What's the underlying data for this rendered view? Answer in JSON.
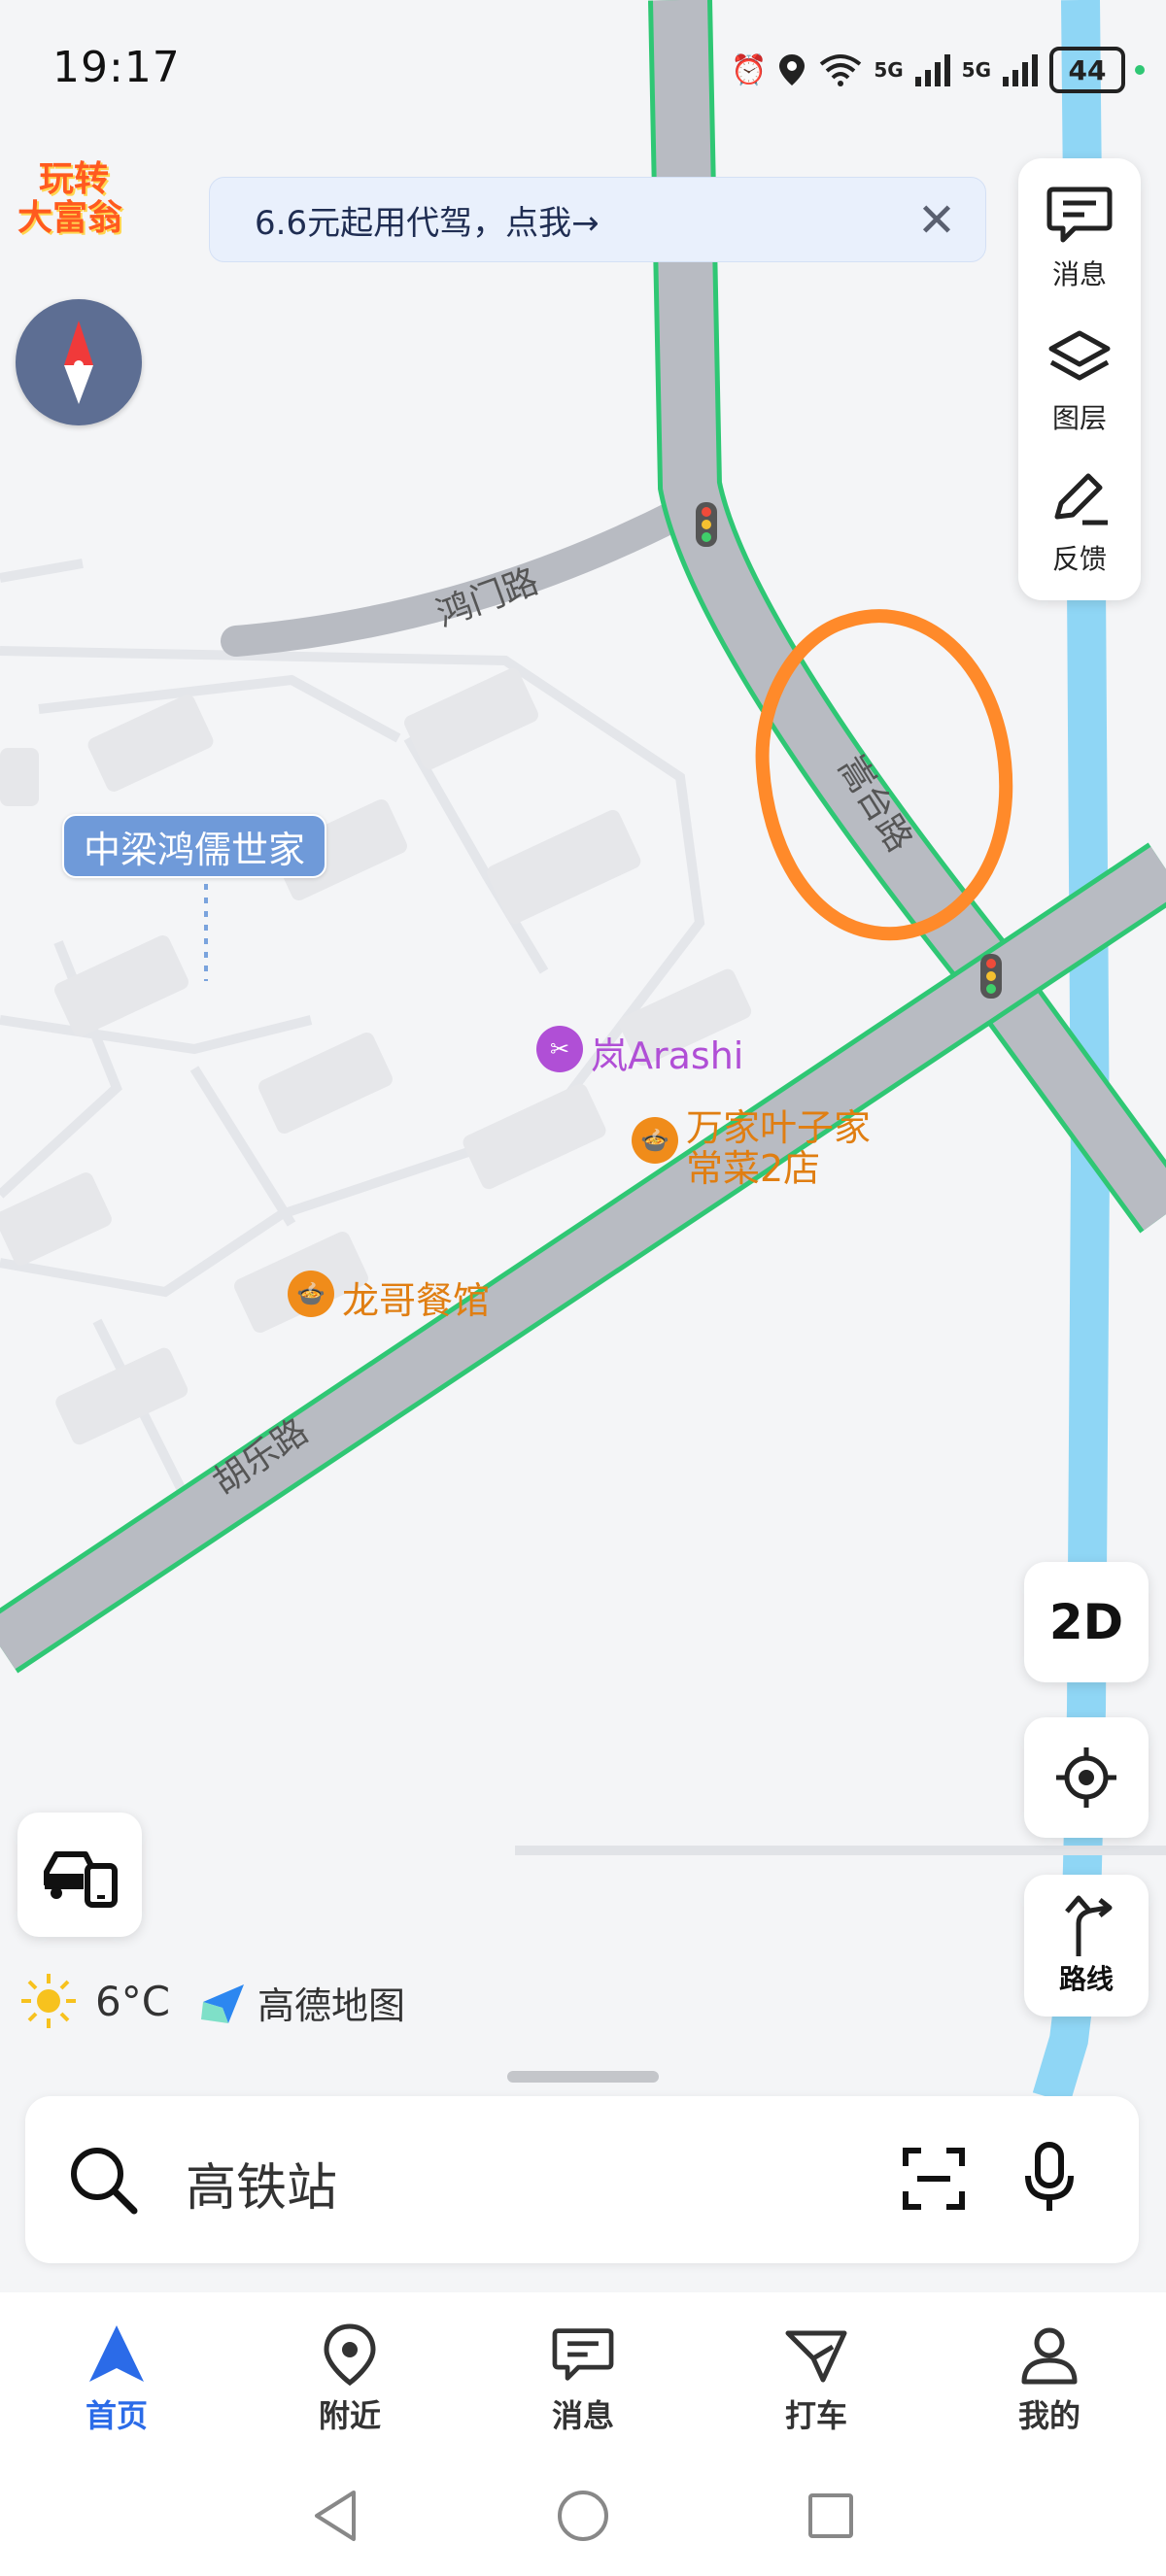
{
  "status_bar": {
    "time": "19:17",
    "battery": "44",
    "net1": "5G",
    "net2": "5G"
  },
  "promo": {
    "logo_line1": "玩转",
    "logo_line2": "大富翁",
    "banner_text": "6.6元起用代驾，点我→"
  },
  "map": {
    "roads": {
      "honmen": "鸿门路",
      "songtai": "嵩台路",
      "hule": "胡乐路"
    },
    "community": "中梁鸿儒世家",
    "pois": [
      {
        "name": "岚Arashi",
        "color": "#b04fd6"
      },
      {
        "name_line1": "万家叶子家",
        "name_line2": "常菜2店",
        "color": "#f08c1a"
      },
      {
        "name": "龙哥餐馆",
        "color": "#f08c1a"
      }
    ]
  },
  "right_panel": {
    "messages": "消息",
    "layers": "图层",
    "feedback": "反馈"
  },
  "controls": {
    "mode_2d": "2D",
    "route": "路线"
  },
  "weather": {
    "temp": "6°C",
    "brand": "高德地图"
  },
  "search": {
    "placeholder": "高铁站"
  },
  "tabs": [
    {
      "label": "首页"
    },
    {
      "label": "附近"
    },
    {
      "label": "消息"
    },
    {
      "label": "打车"
    },
    {
      "label": "我的"
    }
  ],
  "colors": {
    "accent": "#2b6be8",
    "road": "#b8bbc2",
    "road_edge": "#2fc774",
    "river": "#8fd6f5",
    "annotation": "#ff8a2a"
  }
}
